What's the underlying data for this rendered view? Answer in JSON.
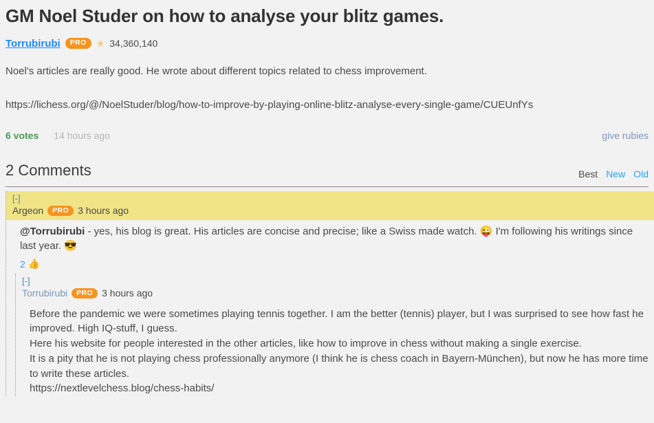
{
  "post": {
    "title": "GM Noel Studer on how to analyse your blitz games.",
    "author": "Torrubirubi",
    "pro_badge": "PRO",
    "star_icon": "star-icon",
    "points": "34,360,140",
    "body": "Noel's articles are really good. He wrote about different topics related to chess improvement.",
    "url": "https://lichess.org/@/NoelStuder/blog/how-to-improve-by-playing-online-blitz-analyse-every-single-game/CUEUnfYs",
    "votes": "6 votes",
    "timeago": "14 hours ago",
    "give_rubies": "give rubies"
  },
  "comments_section": {
    "count_label": "2 Comments",
    "sorts": [
      {
        "label": "Best",
        "active": true
      },
      {
        "label": "New",
        "active": false
      },
      {
        "label": "Old",
        "active": false
      }
    ]
  },
  "comments": [
    {
      "collapse_toggle": "[-]",
      "author": "Argeon",
      "pro_badge": "PRO",
      "timeago": "3 hours ago",
      "highlighted": true,
      "mention": "@Torrubirubi",
      "body_part1": " - yes, his blog is great. His articles are concise and precise; like a Swiss made watch. ",
      "emoji1": "😜",
      "body_part2": " I'm following his writings since last year. ",
      "emoji2": "😎",
      "vote_count": "2",
      "thumb_icon": "thumbs-up-icon"
    },
    {
      "collapse_toggle": "[-]",
      "author": "Torrubirubi",
      "pro_badge": "PRO",
      "timeago": "3 hours ago",
      "highlighted": false,
      "line1": "Before the pandemic we were sometimes playing tennis together. I am the better (tennis) player, but I was surprised to see how fast he improved. High IQ-stuff, I guess.",
      "line2": "Here his website for people interested in the other articles, like how to improve in chess without making a single exercise.",
      "line3": "It is a pity that he is not playing chess professionally anymore (I think he is chess coach in Bayern-München), but now he has more time to write these articles.",
      "line4": "https://nextlevelchess.blog/chess-habits/"
    }
  ]
}
